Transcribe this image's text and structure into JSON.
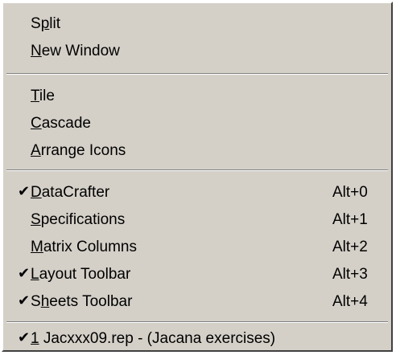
{
  "menu": {
    "groups": [
      {
        "items": [
          {
            "pre": "S",
            "key": "p",
            "post": "lit",
            "shortcut": "",
            "checked": false
          },
          {
            "pre": "",
            "key": "N",
            "post": "ew Window",
            "shortcut": "",
            "checked": false
          }
        ]
      },
      {
        "items": [
          {
            "pre": "",
            "key": "T",
            "post": "ile",
            "shortcut": "",
            "checked": false
          },
          {
            "pre": "",
            "key": "C",
            "post": "ascade",
            "shortcut": "",
            "checked": false
          },
          {
            "pre": "",
            "key": "A",
            "post": "rrange Icons",
            "shortcut": "",
            "checked": false
          }
        ]
      },
      {
        "items": [
          {
            "pre": "",
            "key": "D",
            "post": "ataCrafter",
            "shortcut": "Alt+0",
            "checked": true
          },
          {
            "pre": "",
            "key": "S",
            "post": "pecifications",
            "shortcut": "Alt+1",
            "checked": false
          },
          {
            "pre": "",
            "key": "M",
            "post": "atrix Columns",
            "shortcut": "Alt+2",
            "checked": false
          },
          {
            "pre": "",
            "key": "L",
            "post": "ayout Toolbar",
            "shortcut": "Alt+3",
            "checked": true
          },
          {
            "pre": "S",
            "key": "h",
            "post": "eets Toolbar",
            "shortcut": "Alt+4",
            "checked": true
          }
        ]
      },
      {
        "items": [
          {
            "pre": "",
            "key": "1",
            "post": " Jacxxx09.rep - (Jacana exercises)",
            "shortcut": "",
            "checked": true
          }
        ]
      }
    ],
    "check_glyph": "✔"
  }
}
